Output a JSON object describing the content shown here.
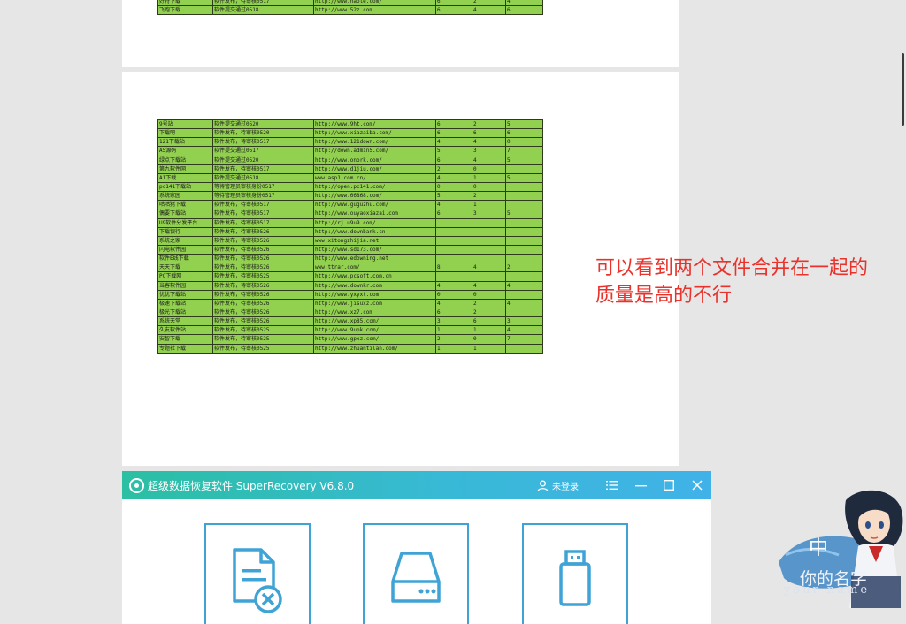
{
  "top_sheet": {
    "rows": [
      [
        "好特下载",
        "软件发布，待审核0517",
        "http://www.haote.com/",
        "6",
        "2",
        "4"
      ],
      [
        "飞跑下载",
        "软件提交通过0518",
        "http://www.52z.com",
        "6",
        "4",
        "6"
      ]
    ]
  },
  "main_sheet": {
    "rows": [
      [
        "9号站",
        "软件提交通过0520",
        "http://www.9ht.com/",
        "6",
        "2",
        "5"
      ],
      [
        "下载吧",
        "软件发布，待审核0520",
        "http://www.xiazaiba.com/",
        "6",
        "6",
        "6"
      ],
      [
        "121下载站",
        "软件发布，待审核0517",
        "http://www.121down.com/",
        "4",
        "4",
        "0"
      ],
      [
        "A5源码",
        "软件提交通过0517",
        "http://down.admin5.com/",
        "5",
        "3",
        "7"
      ],
      [
        "绿点下载站",
        "软件提交通过0520",
        "http://www.onork.com/",
        "6",
        "4",
        "5"
      ],
      [
        "第九软件网",
        "软件发布，待审核0517",
        "http://www.d1jiu.com/",
        "2",
        "0",
        ""
      ],
      [
        "A1下载",
        "软件提交通过0518",
        "www.asp1.com.cn/",
        "4",
        "1",
        "5"
      ],
      [
        "pc141下载站",
        "等待管理员审核身份0517",
        "http://open.pc141.com/",
        "0",
        "0",
        ""
      ],
      [
        "系统家园",
        "等待管理员审核身份0517",
        "http://www.66868.com/",
        "5",
        "2",
        ""
      ],
      [
        "咕咕猪下载",
        "软件发布，待审核0517",
        "http://www.guguzhu.com/",
        "4",
        "1",
        ""
      ],
      [
        "偶要下载站",
        "软件发布，待审核0517",
        "http://www.ouyaoxiazai.com",
        "6",
        "3",
        "5"
      ],
      [
        "U9软件分发平台",
        "软件发布，待审核0517",
        "http://rj.u9u9.com/",
        "",
        "",
        ""
      ],
      [
        "下载银行",
        "软件发布，待审核0526",
        "http://www.downbank.cn",
        "",
        "",
        ""
      ],
      [
        "系统之家",
        "软件发布，待审核0526",
        "www.xitongzhijia.net",
        "",
        "",
        ""
      ],
      [
        "闪电软件园",
        "软件发布，待审核0526",
        "http://www.sd173.com/",
        "",
        "",
        ""
      ],
      [
        "软件E线下载",
        "软件发布，待审核0526",
        "http://www.edowning.net",
        "",
        "",
        ""
      ],
      [
        "天天下载",
        "软件发布，待审核0526",
        "www.ttrar.com/",
        "8",
        "4",
        "2"
      ],
      [
        "PC下载网",
        "软件发布，待审核0525",
        "http://www.pcsoft.com.cn",
        "",
        "",
        ""
      ],
      [
        "当客软件园",
        "软件发布，待审核0526",
        "http://www.downkr.com",
        "4",
        "4",
        "4"
      ],
      [
        "优优下载站",
        "软件发布，待审核0526",
        "http://www.yxyxt.com",
        "0",
        "0",
        ""
      ],
      [
        "极速下载站",
        "软件发布，待审核0526",
        "http://www.jisuxz.com",
        "4",
        "2",
        "4"
      ],
      [
        "极光下载站",
        "软件发布，待审核0526",
        "http://www.xz7.com",
        "6",
        "2",
        ""
      ],
      [
        "系统天堂",
        "软件发布，待审核0526",
        "http://www.xp85.com/",
        "3",
        "6",
        "3"
      ],
      [
        "久友软件站",
        "软件发布，待审核0525",
        "http://www.9upk.com/",
        "1",
        "1",
        "4"
      ],
      [
        "安智下载",
        "软件发布，待审核0525",
        "http://www.gpxz.com/",
        "2",
        "0",
        "7"
      ],
      [
        "专题社下载",
        "软件发布，待审核0525",
        "http://www.zhuantilan.com/",
        "1",
        "1",
        ""
      ]
    ]
  },
  "annotation": {
    "line1": "可以看到两个文件合并在一起的",
    "line2": "质量是高的不行"
  },
  "app_window": {
    "title": "超级数据恢复软件 SuperRecovery V6.8.0",
    "login_label": "未登录",
    "icons": {
      "user": "user-icon",
      "menu": "menu-icon",
      "minimize": "minimize-icon",
      "maximize": "maximize-icon",
      "close": "close-icon"
    },
    "cards": [
      {
        "icon": "deleted-file-icon"
      },
      {
        "icon": "hard-disk-icon"
      },
      {
        "icon": "usb-drive-icon"
      }
    ],
    "colors": {
      "title_start": "#2bbfa3",
      "title_end": "#41b2e8",
      "card_border": "#3fa3d6",
      "icon": "#3fa3d6"
    }
  },
  "watermark": {
    "char": "中",
    "text": "你的名字",
    "sub": "your name"
  },
  "colors": {
    "sheet_fill": "#92d050",
    "annotation": "#e8322b"
  }
}
